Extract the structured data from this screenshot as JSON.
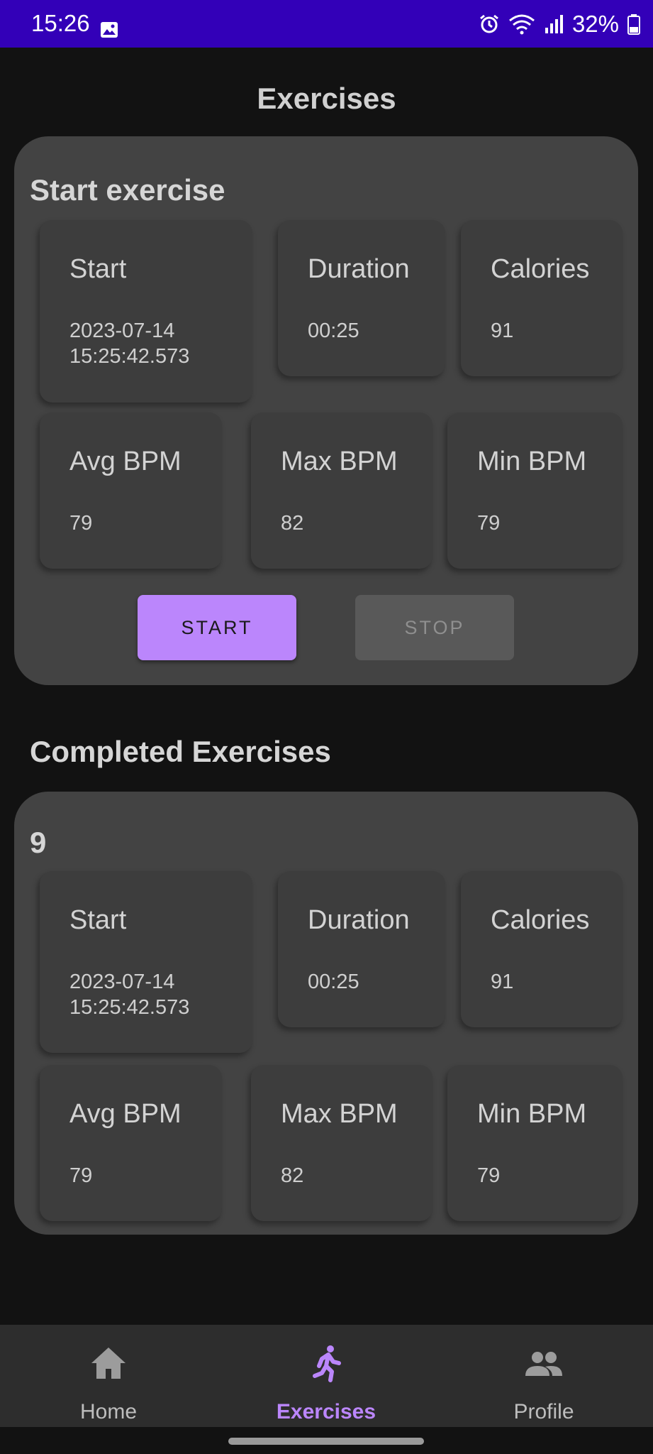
{
  "status_bar": {
    "time": "15:26",
    "battery": "32%"
  },
  "header": {
    "title": "Exercises"
  },
  "current": {
    "heading": "Start exercise",
    "cards": [
      {
        "label": "Start",
        "value": "2023-07-14\n15:25:42.573"
      },
      {
        "label": "Duration",
        "value": "00:25"
      },
      {
        "label": "Calories",
        "value": "91"
      },
      {
        "label": "Avg BPM",
        "value": "79"
      },
      {
        "label": "Max BPM",
        "value": "82"
      },
      {
        "label": "Min BPM",
        "value": "79"
      }
    ],
    "start_label": "START",
    "stop_label": "STOP"
  },
  "completed": {
    "title": "Completed Exercises",
    "item": {
      "id": "9",
      "cards": [
        {
          "label": "Start",
          "value": "2023-07-14\n15:25:42.573"
        },
        {
          "label": "Duration",
          "value": "00:25"
        },
        {
          "label": "Calories",
          "value": "91"
        },
        {
          "label": "Avg BPM",
          "value": "79"
        },
        {
          "label": "Max BPM",
          "value": "82"
        },
        {
          "label": "Min BPM",
          "value": "79"
        }
      ]
    }
  },
  "nav": {
    "items": [
      {
        "label": "Home",
        "icon": "home-icon"
      },
      {
        "label": "Exercises",
        "icon": "running-icon",
        "active": true
      },
      {
        "label": "Profile",
        "icon": "people-icon"
      }
    ]
  },
  "colors": {
    "accent": "#bb86fc",
    "status_bar": "#3300b8",
    "panel": "#434343",
    "background": "#121212"
  }
}
